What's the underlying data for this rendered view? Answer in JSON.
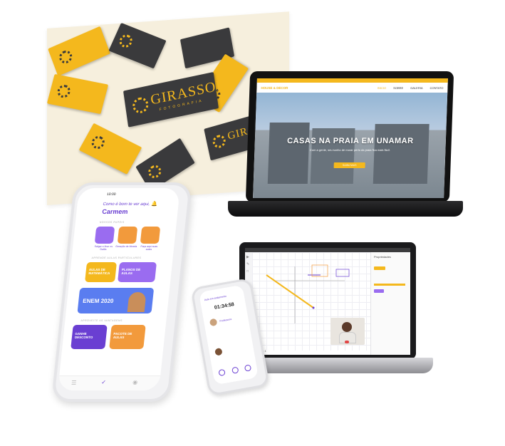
{
  "colors": {
    "brand_yellow": "#f4b81d",
    "charcoal": "#3a3a3c",
    "purple": "#6a3fd2",
    "orange": "#f29a3c",
    "violet": "#9a6cf0",
    "blue": "#5a7df0"
  },
  "business_cards": {
    "brand": "GIRASSOL",
    "brand_sub": "FOTOGRAFIA"
  },
  "laptop_site": {
    "logo": "HOUSE & DECOR",
    "nav": [
      "INICIO",
      "SOBRE",
      "GALERIA",
      "CONTATO"
    ],
    "hero_title": "CASAS NA PRAIA EM UNAMAR",
    "hero_sub": "Com a gente, seu sonho de morar perto da praia fica mais fácil.",
    "hero_button": "SAIBA MAIS"
  },
  "phone_app": {
    "time": "10:00",
    "greeting": "Como é bom te ver aqui,",
    "user_name": "Carmem",
    "section_1": "NOSSOS PAPEIS",
    "tiles": [
      "Salgar e ficar os Galãs",
      "Geração de Moeda",
      "Faça aqui suas aulas"
    ],
    "section_2": "APRENDE AULAS PARTICULARES",
    "banner_a": "AULAS DE MATEMÁTICA",
    "banner_b": "PLANOS DE AULAS",
    "banner_enem": "ENEM 2020",
    "section_3": "APROVEITE AS VANTAGENS",
    "banner_c": "GANHE DESCONTO",
    "banner_d": "PACOTE DE AULAS"
  },
  "laptop_tool": {
    "panel_title": "Propriedades",
    "page_label": "Página 1"
  },
  "phone_small": {
    "title": "Aula em andamento",
    "timer": "01:34:58",
    "label": "Professora"
  }
}
